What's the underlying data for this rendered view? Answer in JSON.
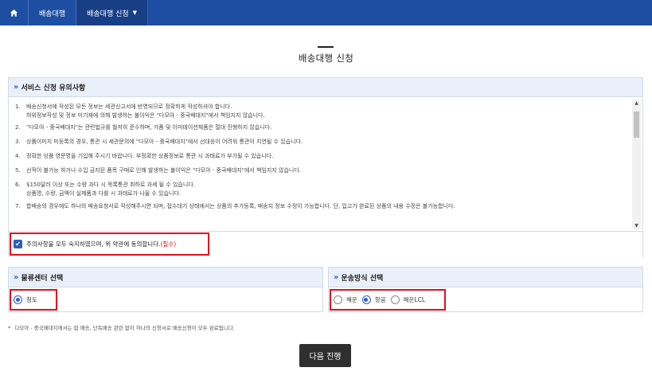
{
  "nav": {
    "home_icon": "home-icon",
    "items": [
      {
        "label": "배송대행"
      },
      {
        "label": "배송대행 신청",
        "caret": "▼"
      }
    ]
  },
  "page": {
    "title": "배송대행 신청"
  },
  "notice": {
    "heading_chevron": "»",
    "heading": "서비스 신청 유의사항",
    "items": [
      {
        "num": "1.",
        "lines": [
          "배송신청서에 작성된 모든 정보는 세관신고서에 반영되므로 정확하게 작성하셔야 합니다.",
          "허위정보작성 및 정보 미기재에 의해 발생하는 불이익은 \"다모아 - 중국배대지\"에서 책임지지 않습니다."
        ]
      },
      {
        "num": "2.",
        "lines": [
          "\"다모아 - 중국배대지\"는 관련법규를 철저히 준수하며, 가품 및 이미테이션제품은 절대 진행하지 않습니다."
        ]
      },
      {
        "num": "3.",
        "lines": [
          "상품이미지 미등록의 경우, 통관 시 세관문의에 \"다모아 - 중국배대지\"에서 선대응이 어려워 통관이 지연될 수 있습니다."
        ]
      },
      {
        "num": "4.",
        "lines": [
          "정확한 상품 영문명을 기입해 주시기 바랍니다. 부정확한 상품정보로 통관 시 과태료가 부가될 수 있습니다."
        ]
      },
      {
        "num": "5.",
        "lines": [
          "선적이 불가능 하거나 수입 금지된 품목 구매로 인해 발생하는 불이익은 \"다모아 - 중국배대지\"에서 책임지지 않습니다."
        ]
      },
      {
        "num": "6.",
        "lines": [
          "$150달러 이상 또는 수량 과다 시 목록통관 취하로 과세 될 수 있습니다.",
          "상품명, 수량, 금액이 실제품과 다를 시 과태료가 나올 수 있습니다."
        ]
      },
      {
        "num": "7.",
        "lines": [
          "합배송의 경우에도 하나의 배송요청서로 작성해주시면 되며, 접수대기 상태에서는 상품의 추가등록, 배송지 정보 수정이 가능합니다. 단, 입고가 완료된 상품의 내용 수정은 불가능합니다."
        ]
      }
    ],
    "scroll_up": "▲",
    "scroll_down": "▼",
    "agree": {
      "checked": true,
      "check_glyph": "✔",
      "label": "주의사항을 모두 숙지하였으며, 위 약관에 동의합니다.",
      "required": "(필수)"
    }
  },
  "center": {
    "heading_chevron": "»",
    "heading": "물류센터 선택",
    "options": [
      {
        "label": "청도",
        "selected": true
      }
    ]
  },
  "shipping": {
    "heading_chevron": "»",
    "heading": "운송방식 선택",
    "options": [
      {
        "label": "해운",
        "selected": false
      },
      {
        "label": "항공",
        "selected": true
      },
      {
        "label": "해운LCL",
        "selected": false
      }
    ]
  },
  "footnote": {
    "star": "*",
    "text": "다모아 - 중국배대지에서는 합 배송, 단독배송 관련 없이 하나의 신청서로 배송신청이 모두 완료됩니다."
  },
  "next_button": {
    "label": "다음 진행"
  },
  "colors": {
    "nav_bg": "#1e4ea1",
    "accent": "#2a5fc4",
    "highlight_red": "#e0101b",
    "button_bg": "#2f2f2f"
  }
}
